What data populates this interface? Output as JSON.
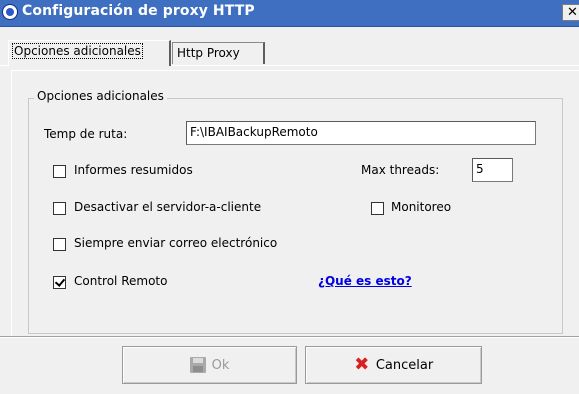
{
  "window": {
    "title": "Configuración de proxy HTTP",
    "close_glyph": "✕"
  },
  "tabs": [
    {
      "label": "Opciones adicionales",
      "active": true
    },
    {
      "label": "Http Proxy",
      "active": false
    }
  ],
  "group": {
    "title": "Opciones adicionales"
  },
  "fields": {
    "temp_ruta_label": "Temp de ruta:",
    "temp_ruta_value": "F:\\IBAIBackupRemoto",
    "max_threads_label": "Max threads:",
    "max_threads_value": "5"
  },
  "checkboxes": {
    "informes_resumidos": {
      "label": "Informes resumidos",
      "checked": false
    },
    "desactivar_servidor": {
      "label": "Desactivar el servidor-a-cliente",
      "checked": false
    },
    "monitoreo": {
      "label": "Monitoreo",
      "checked": false
    },
    "siempre_enviar_correo": {
      "label": "Siempre enviar correo electrónico",
      "checked": false
    },
    "control_remoto": {
      "label": "Control Remoto",
      "checked": true
    }
  },
  "links": {
    "que_es_esto": "¿Qué es esto?"
  },
  "buttons": {
    "ok_label": "Ok",
    "ok_enabled": false,
    "cancel_label": "Cancelar"
  },
  "icons": {
    "title_icon": "app-globe-icon",
    "ok_icon": "floppy-disk-icon",
    "cancel_icon": "red-x-icon"
  }
}
